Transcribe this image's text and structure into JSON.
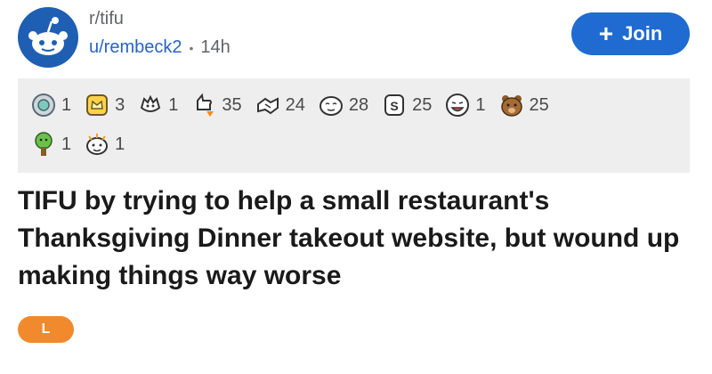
{
  "post": {
    "subreddit": "r/tifu",
    "author": "u/rembeck2",
    "separator": "•",
    "age": "14h",
    "join_label": "Join",
    "title": "TIFU by trying to help a small restaurant's Thanksgiving Dinner takeout website, but wound up making things way worse",
    "flair": "L"
  },
  "awards": [
    {
      "icon": "silver-medal-icon",
      "count": "1"
    },
    {
      "icon": "gold-crown-icon",
      "count": "3"
    },
    {
      "icon": "wholesome-hand-icon",
      "count": "1"
    },
    {
      "icon": "rocket-like-icon",
      "count": "35"
    },
    {
      "icon": "handshake-icon",
      "count": "24"
    },
    {
      "icon": "facepalm-face-icon",
      "count": "28"
    },
    {
      "icon": "s-coin-icon",
      "count": "25"
    },
    {
      "icon": "laughing-face-icon",
      "count": "1"
    },
    {
      "icon": "bear-icon",
      "count": "25"
    },
    {
      "icon": "tree-icon",
      "count": "1"
    },
    {
      "icon": "snoo-cheer-icon",
      "count": "1"
    }
  ],
  "colors": {
    "accent": "#1f6bd1",
    "flair": "#f08a2c",
    "award_bar": "#eeeeee"
  }
}
